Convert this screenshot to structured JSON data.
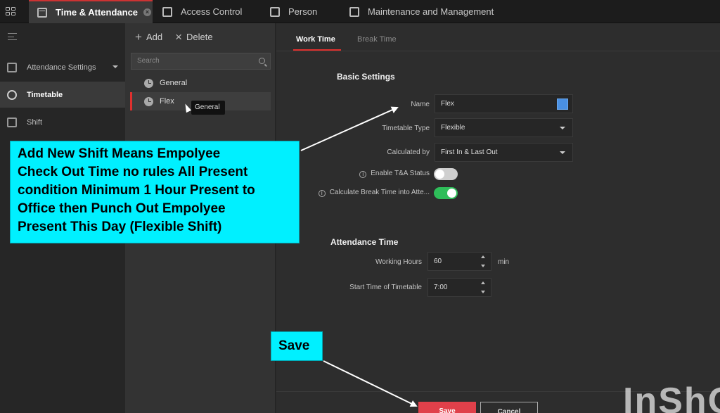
{
  "top_tabs": [
    {
      "label": "Time & Attendance",
      "active": true
    },
    {
      "label": "Access Control",
      "active": false
    },
    {
      "label": "Person",
      "active": false
    },
    {
      "label": "Maintenance and Management",
      "active": false
    }
  ],
  "left_nav": {
    "items": [
      {
        "label": "Attendance Settings",
        "icon": "calendar-icon"
      },
      {
        "label": "Timetable",
        "icon": "clock-icon",
        "active": true
      },
      {
        "label": "Shift",
        "icon": "shift-icon"
      }
    ]
  },
  "timetable_panel": {
    "add_label": "Add",
    "delete_label": "Delete",
    "search_placeholder": "Search",
    "items": [
      {
        "label": "General"
      },
      {
        "label": "Flex",
        "selected": true
      }
    ],
    "tooltip": "General"
  },
  "detail": {
    "tabs": [
      {
        "label": "Work Time",
        "active": true
      },
      {
        "label": "Break Time",
        "active": false
      }
    ],
    "basic_settings_title": "Basic Settings",
    "name_label": "Name",
    "name_value": "Flex",
    "name_color": "#4a90e2",
    "timetable_type_label": "Timetable Type",
    "timetable_type_value": "Flexible",
    "calculated_by_label": "Calculated by",
    "calculated_by_value": "First In & Last Out",
    "enable_ta_status_label": "Enable T&A Status",
    "enable_ta_status_on": false,
    "calc_break_label": "Calculate Break Time into Atte...",
    "calc_break_on": true,
    "attendance_time_title": "Attendance Time",
    "working_hours_label": "Working Hours",
    "working_hours_value": "60",
    "working_hours_unit": "min",
    "start_time_label": "Start Time of Timetable",
    "start_time_value": "7:00",
    "save_label": "Save",
    "cancel_label": "Cancel"
  },
  "annotations": {
    "main_note": "Add New Shift Means  Empolyee\nCheck Out Time no rules All Present\ncondition Minimum 1 Hour Present to\nOffice then Punch Out Empolyee\nPresent This Day   (Flexible Shift)",
    "save_note": "Save",
    "color": "#00f0ff"
  },
  "watermark": "InShO"
}
